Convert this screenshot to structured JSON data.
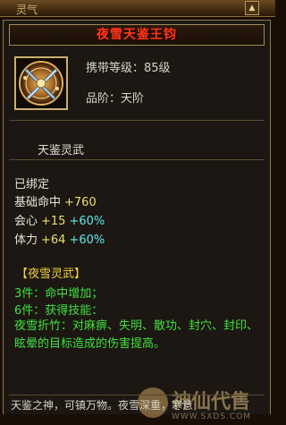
{
  "top_strip": {
    "text": "灵气",
    "arrow": "▲"
  },
  "item": {
    "name": "夜雪天鉴王钧",
    "name_color": "#ff3a1a",
    "icon": "crossed-blades-emblem-icon",
    "level_label": "携带等级：",
    "level_value": "85级",
    "grade_label": "品阶：",
    "grade_value": "天阶"
  },
  "section_title": "天鉴灵武",
  "bound_status": "已绑定",
  "stats": [
    {
      "name": "基础命中",
      "value": "+760",
      "extra": ""
    },
    {
      "name": "会心",
      "value": "+15",
      "extra": "+60%"
    },
    {
      "name": "体力",
      "value": "+64",
      "extra": "+60%"
    }
  ],
  "set": {
    "title": "【夜雪灵武】",
    "bonuses": [
      {
        "label": "3件：",
        "text": "命中增加；"
      },
      {
        "label": "6件：",
        "text": "获得技能："
      }
    ],
    "effect": "夜雪折竹：对麻痹、失明、散功、封穴、封印、眩晕的目标造成的伤害提高。"
  },
  "watermark": {
    "name": "神仙代售",
    "url": "WWW.SXDS.COM"
  },
  "bottom_text": "天鉴之神，可镇万物。夜雪深重，寒意"
}
